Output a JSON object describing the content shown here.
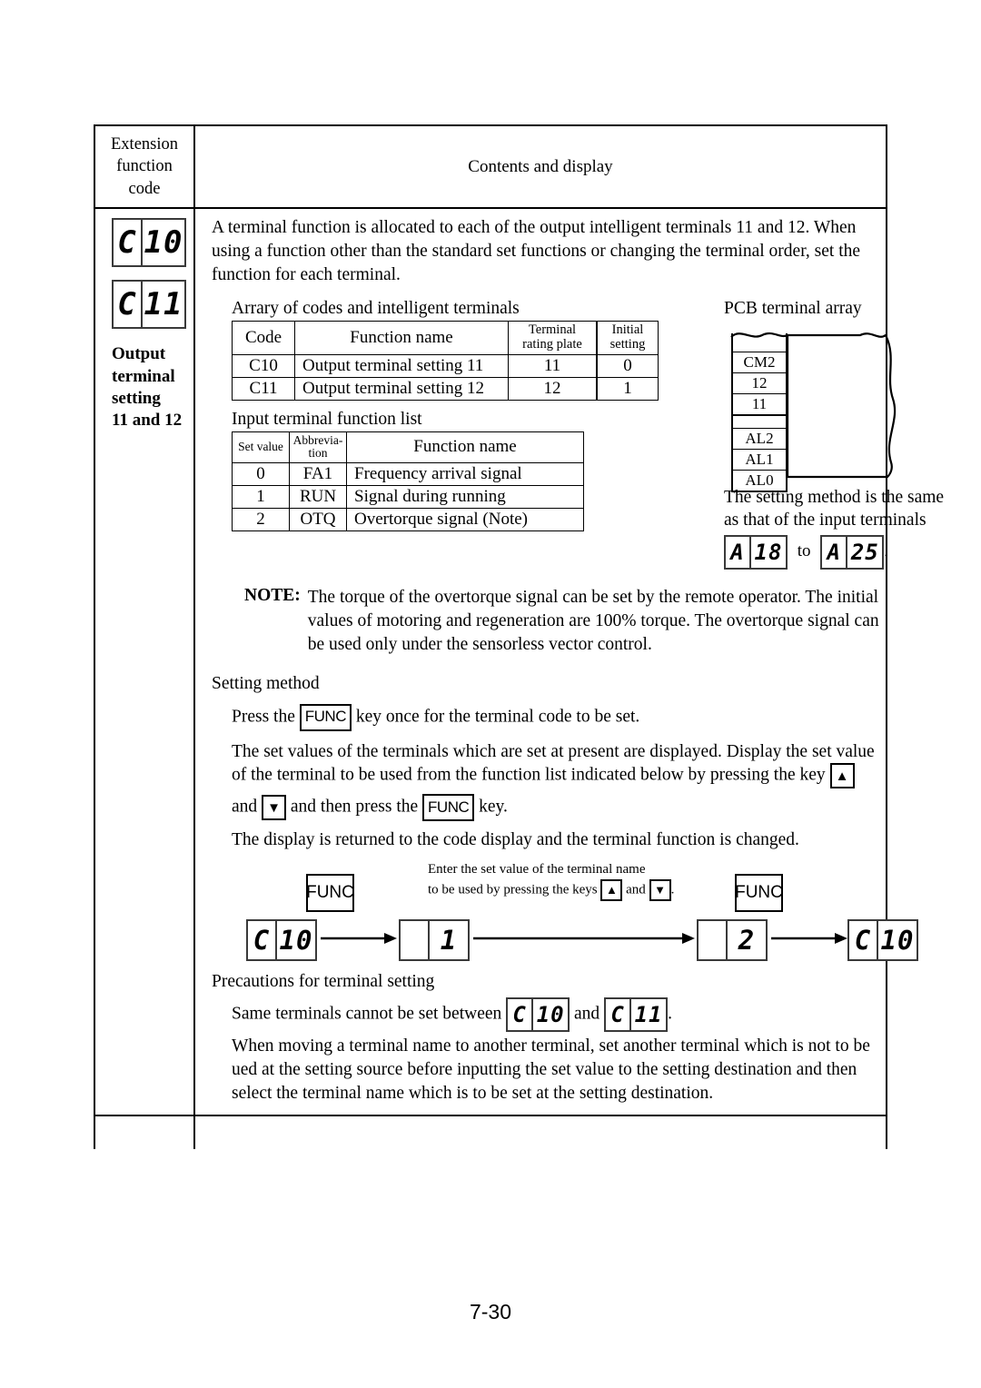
{
  "page": {
    "number": "7-30"
  },
  "table_header": {
    "code_column": "Extension\nfunction\ncode",
    "code_column_l1": "Extension",
    "code_column_l2": "function",
    "code_column_l3": "code",
    "contents_column": "Contents and display"
  },
  "code_cell": {
    "display_1": {
      "char1": "C",
      "char2": "10"
    },
    "display_2": {
      "char1": "C",
      "char2": "11"
    },
    "label_l1": "Output",
    "label_l2": "terminal",
    "label_l3": "setting",
    "label_l4": "11 and 12"
  },
  "intro": {
    "paragraph": "A terminal function is allocated to each of the output intelligent terminals 11 and 12.  When using a function other than the standard set functions or changing the terminal order, set the function for each terminal."
  },
  "array_table": {
    "title": "Arrary of codes and intelligent terminals",
    "headers": {
      "code": "Code",
      "function_name": "Function name",
      "terminal_rating_l1": "Terminal",
      "terminal_rating_l2": "rating plate",
      "initial_l1": "Initial",
      "initial_l2": "setting"
    },
    "rows": [
      {
        "code": "C10",
        "function_name": "Output terminal setting 11",
        "terminal": "11",
        "initial": "0"
      },
      {
        "code": "C11",
        "function_name": "Output terminal setting 12",
        "terminal": "12",
        "initial": "1"
      }
    ]
  },
  "function_list": {
    "title": "Input terminal function list",
    "headers": {
      "set_value": "Set value",
      "abbrev_l1": "Abbrevia-",
      "abbrev_l2": "tion",
      "function_name": "Function name"
    },
    "rows": [
      {
        "set_value": "0",
        "abbrev": "FA1",
        "function_name": "Frequency arrival signal"
      },
      {
        "set_value": "1",
        "abbrev": "RUN",
        "function_name": "Signal during running"
      },
      {
        "set_value": "2",
        "abbrev": "OTQ",
        "function_name": "Overtorque signal (Note)"
      }
    ]
  },
  "pcb": {
    "title": "PCB terminal array",
    "terminals": [
      "CM2",
      "12",
      "11"
    ],
    "terminals_lower": [
      "AL2",
      "AL1",
      "AL0"
    ],
    "note_l1": "The setting method is the same",
    "note_l2": "as that of the input terminals",
    "range_from": {
      "char1": "A",
      "char2": "18"
    },
    "range_to": {
      "char1": "A",
      "char2": "25"
    },
    "range_connector": "to",
    "range_period": "."
  },
  "note": {
    "label": "NOTE:",
    "body": "The torque of the overtorque signal can be set by the remote operator.  The initial values of motoring and regeneration are 100% torque.  The overtorque signal can be used only under the sensorless vector control."
  },
  "setting_method": {
    "title": "Setting method",
    "line1_a": "Press the",
    "func_key": "FUNC",
    "line1_b": "key once for the terminal code to be set.",
    "line2": "The set values of the terminals which are set at present are displayed.  Display the set value of the terminal to be used from the function list indicated below by pressing the key",
    "up_arrow": "▲",
    "line3_a": "and",
    "down_arrow": "▼",
    "line3_b": "and then press the",
    "line3_c": "key.",
    "line4": "The display is returned to the code display and the terminal function is changed."
  },
  "flow": {
    "func_key": "FUNC",
    "caption_l1": "Enter the set value of the terminal name",
    "caption_l2_a": "to be used by pressing the keys",
    "caption_l2_b": "and",
    "caption_l2_c": ".",
    "up_arrow": "▲",
    "down_arrow": "▼",
    "display_start": {
      "char1": "C",
      "char2": "10"
    },
    "display_mid1": {
      "char1": "",
      "char2": "1"
    },
    "display_mid2": {
      "char1": "",
      "char2": "2"
    },
    "display_end": {
      "char1": "C",
      "char2": "10"
    }
  },
  "precautions": {
    "title": "Precautions for terminal setting",
    "line1_a": "Same terminals cannot be set between",
    "code_a": {
      "char1": "C",
      "char2": "10"
    },
    "line1_b": "and",
    "code_b": {
      "char1": "C",
      "char2": "11"
    },
    "line1_c": ".",
    "line2": "When moving a terminal name to another terminal, set another terminal which is not to be ued at the setting source before inputting the set value to the setting destination and then select the terminal name which is to be set at the setting destination."
  }
}
